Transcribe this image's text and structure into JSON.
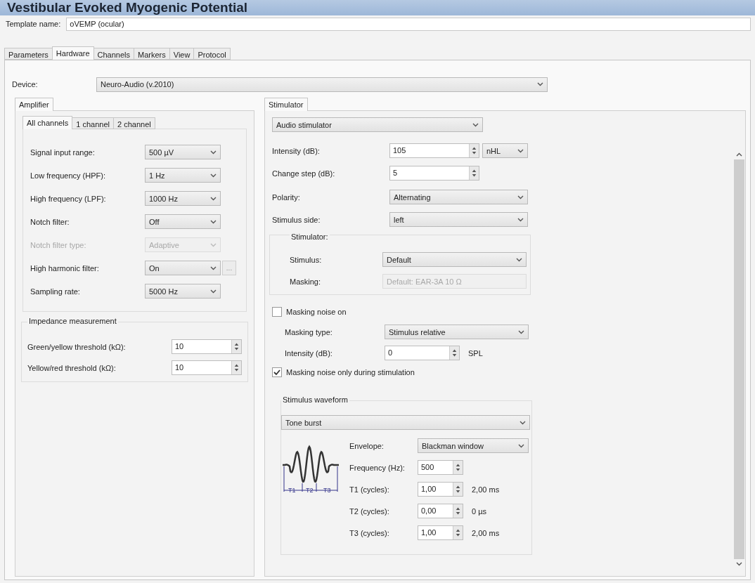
{
  "window": {
    "title": "Vestibular Evoked Myogenic Potential"
  },
  "template": {
    "label": "Template name:",
    "value": "oVEMP (ocular)"
  },
  "tabs": [
    {
      "label": "Parameters",
      "selected": false
    },
    {
      "label": "Hardware",
      "selected": true
    },
    {
      "label": "Channels",
      "selected": false
    },
    {
      "label": "Markers",
      "selected": false
    },
    {
      "label": "View",
      "selected": false
    },
    {
      "label": "Protocol",
      "selected": false
    }
  ],
  "device": {
    "label": "Device:",
    "value": "Neuro-Audio (v.2010)"
  },
  "amplifier": {
    "tab": "Amplifier",
    "channel_tabs": [
      {
        "label": "All channels",
        "selected": true
      },
      {
        "label": "1 channel",
        "selected": false
      },
      {
        "label": "2 channel",
        "selected": false
      }
    ],
    "rows": [
      {
        "label": "Signal input range:",
        "value": "500 µV",
        "disabled": false
      },
      {
        "label": "Low frequency (HPF):",
        "value": "1 Hz",
        "disabled": false
      },
      {
        "label": "High frequency (LPF):",
        "value": "1000 Hz",
        "disabled": false
      },
      {
        "label": "Notch filter:",
        "value": "Off",
        "disabled": false
      },
      {
        "label": "Notch filter type:",
        "value": "Adaptive",
        "disabled": true
      },
      {
        "label": "High harmonic filter:",
        "value": "On",
        "disabled": false,
        "more_button": "..."
      },
      {
        "label": "Sampling rate:",
        "value": "5000 Hz",
        "disabled": false
      }
    ],
    "impedance": {
      "title": "Impedance measurement",
      "rows": [
        {
          "label": "Green/yellow threshold (kΩ):",
          "value": "10"
        },
        {
          "label": "Yellow/red threshold (kΩ):",
          "value": "10"
        }
      ]
    }
  },
  "stimulator": {
    "tab": "Stimulator",
    "type": "Audio stimulator",
    "rows": [
      {
        "kind": "spin",
        "label": "Intensity (dB):",
        "value": "105",
        "unit_select": "nHL"
      },
      {
        "kind": "spin",
        "label": "Change step (dB):",
        "value": "5"
      },
      {
        "kind": "select",
        "label": "Polarity:",
        "value": "Alternating"
      },
      {
        "kind": "select",
        "label": "Stimulus side:",
        "value": "left"
      }
    ],
    "group": {
      "title": "Stimulator:",
      "rows": [
        {
          "label": "Stimulus:",
          "value": "Default",
          "disabled": false
        },
        {
          "label": "Masking:",
          "value": "Default: EAR-3A 10 Ω",
          "disabled": true
        }
      ]
    },
    "masking_on": {
      "label": "Masking noise on",
      "checked": false
    },
    "masking_rows": [
      {
        "kind": "select",
        "label": "Masking type:",
        "value": "Stimulus relative"
      },
      {
        "kind": "spin",
        "label": "Intensity (dB):",
        "value": "0",
        "unit": "SPL"
      }
    ],
    "masking_only": {
      "label": "Masking noise only during stimulation",
      "checked": true
    },
    "waveform": {
      "title": "Stimulus waveform",
      "type": "Tone burst",
      "rows": [
        {
          "kind": "select",
          "label": "Envelope:",
          "value": "Blackman window"
        },
        {
          "kind": "spin",
          "label": "Frequency (Hz):",
          "value": "500"
        },
        {
          "kind": "spin",
          "label": "T1 (cycles):",
          "value": "1,00",
          "reading": "2,00 ms"
        },
        {
          "kind": "spin",
          "label": "T2 (cycles):",
          "value": "0,00",
          "reading": "0 µs"
        },
        {
          "kind": "spin",
          "label": "T3 (cycles):",
          "value": "1,00",
          "reading": "2,00 ms"
        }
      ],
      "marks": [
        "T1",
        "T2",
        "T3"
      ]
    }
  }
}
